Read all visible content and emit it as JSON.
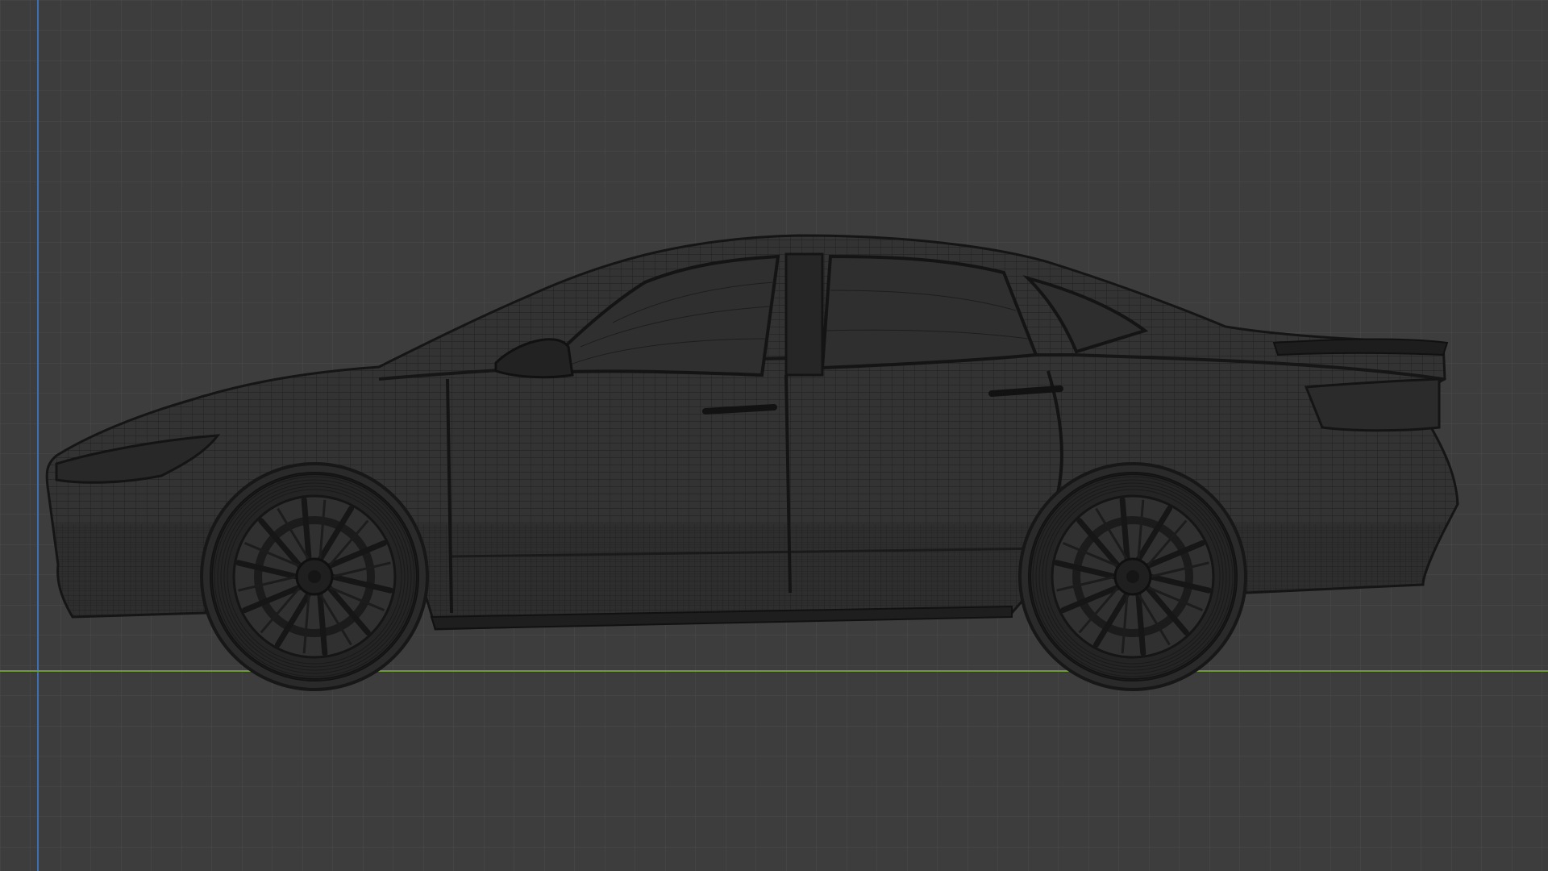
{
  "viewport": {
    "view": "side-orthographic",
    "shading": "wireframe",
    "colors": {
      "background": "#3d3d3d",
      "grid_minor": "#4a4a4a",
      "grid_major": "#555555",
      "x_axis": "#6f9a3c",
      "z_axis": "#3d6ea8",
      "mesh_fill": "#2f2f2f",
      "mesh_wire": "#1e1e1e",
      "mesh_edge": "#151515"
    }
  },
  "object": {
    "type": "sedan car model",
    "display": "wireframe mesh"
  }
}
